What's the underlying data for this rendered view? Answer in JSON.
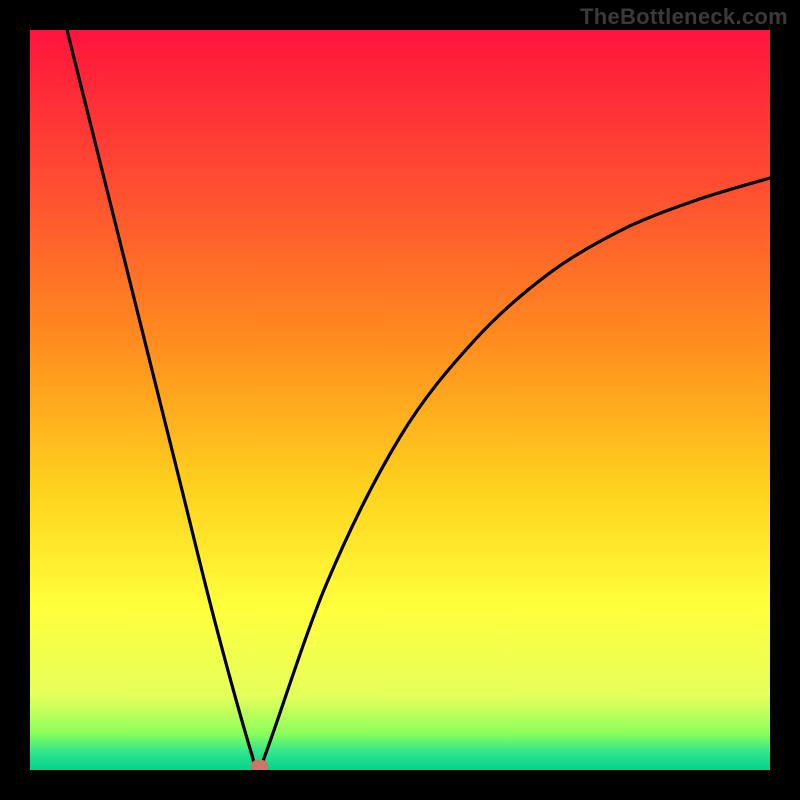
{
  "attribution": "TheBottleneck.com",
  "chart_data": {
    "type": "line",
    "title": "",
    "xlabel": "",
    "ylabel": "",
    "xlim": [
      0,
      100
    ],
    "ylim": [
      0,
      100
    ],
    "x": [
      5,
      10,
      15,
      20,
      25,
      30,
      31,
      40,
      50,
      60,
      70,
      80,
      90,
      100
    ],
    "values": [
      100,
      80,
      60,
      40,
      20,
      2,
      0,
      25,
      45,
      58,
      67,
      73,
      77,
      80
    ],
    "curve_min_x": 31,
    "marker": {
      "x": 31,
      "y": 0,
      "color": "#cc7766"
    },
    "gradient_stops": [
      {
        "offset": 0.0,
        "color": "#ff143c"
      },
      {
        "offset": 0.2,
        "color": "#ff4a32"
      },
      {
        "offset": 0.42,
        "color": "#ff8c1e"
      },
      {
        "offset": 0.62,
        "color": "#ffd21e"
      },
      {
        "offset": 0.78,
        "color": "#ffff3c"
      },
      {
        "offset": 0.9,
        "color": "#e6ff5a"
      },
      {
        "offset": 0.95,
        "color": "#8cff5a"
      },
      {
        "offset": 0.975,
        "color": "#32e68c"
      },
      {
        "offset": 1.0,
        "color": "#00d28c"
      }
    ]
  }
}
